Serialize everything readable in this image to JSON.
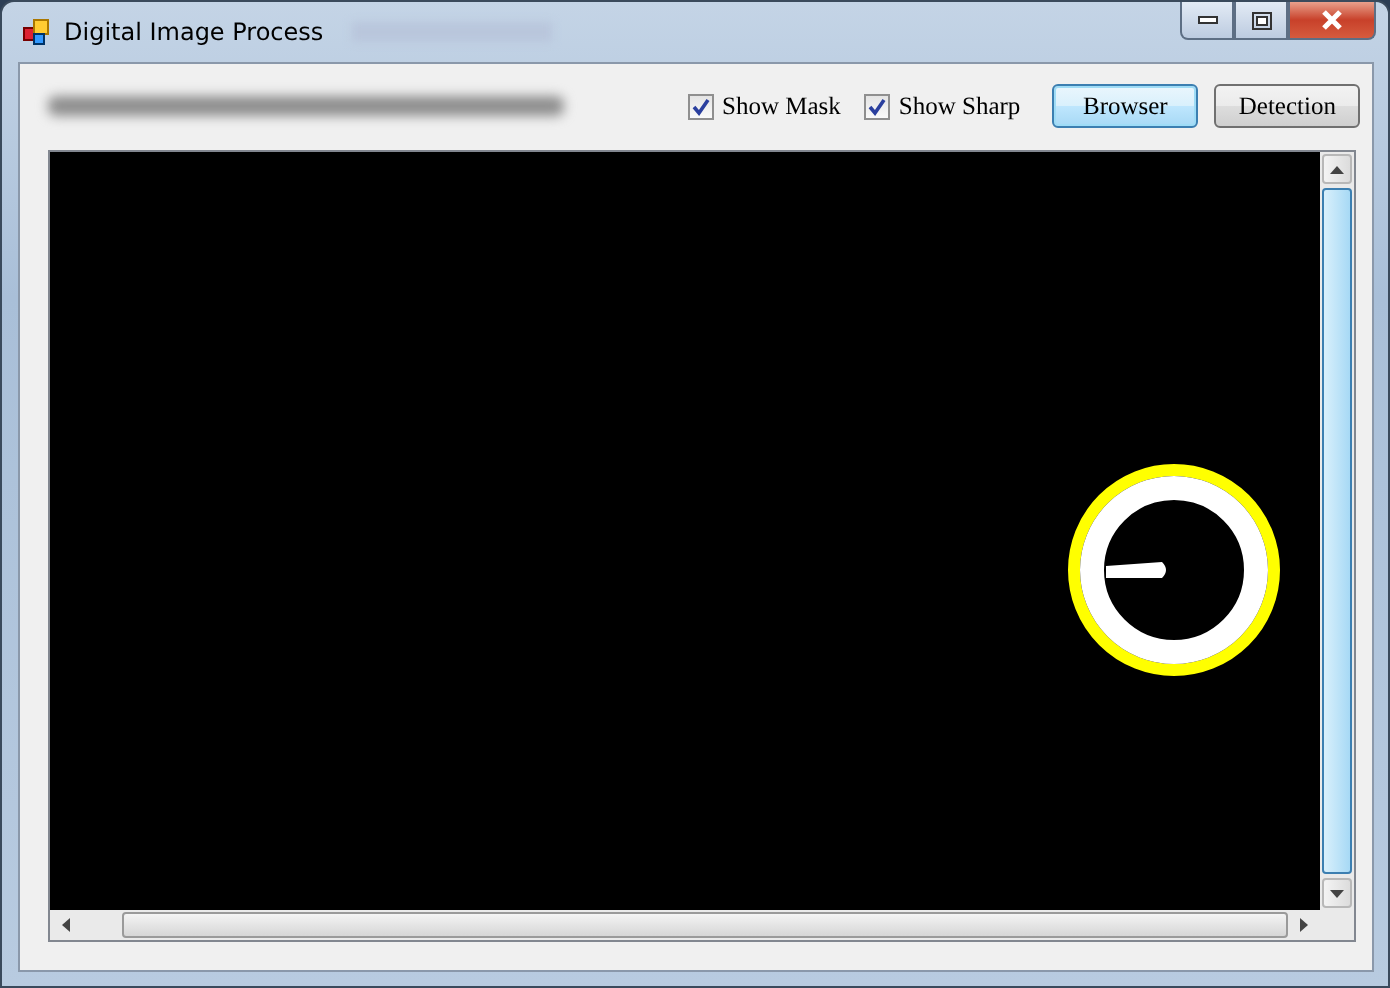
{
  "window": {
    "title": "Digital Image Process"
  },
  "toolbar": {
    "checkboxes": [
      {
        "label": "Show Mask",
        "checked": true
      },
      {
        "label": "Show Sharp",
        "checked": true
      }
    ],
    "buttons": [
      {
        "label": "Browser",
        "focused": true
      },
      {
        "label": "Detection",
        "focused": false
      }
    ]
  }
}
